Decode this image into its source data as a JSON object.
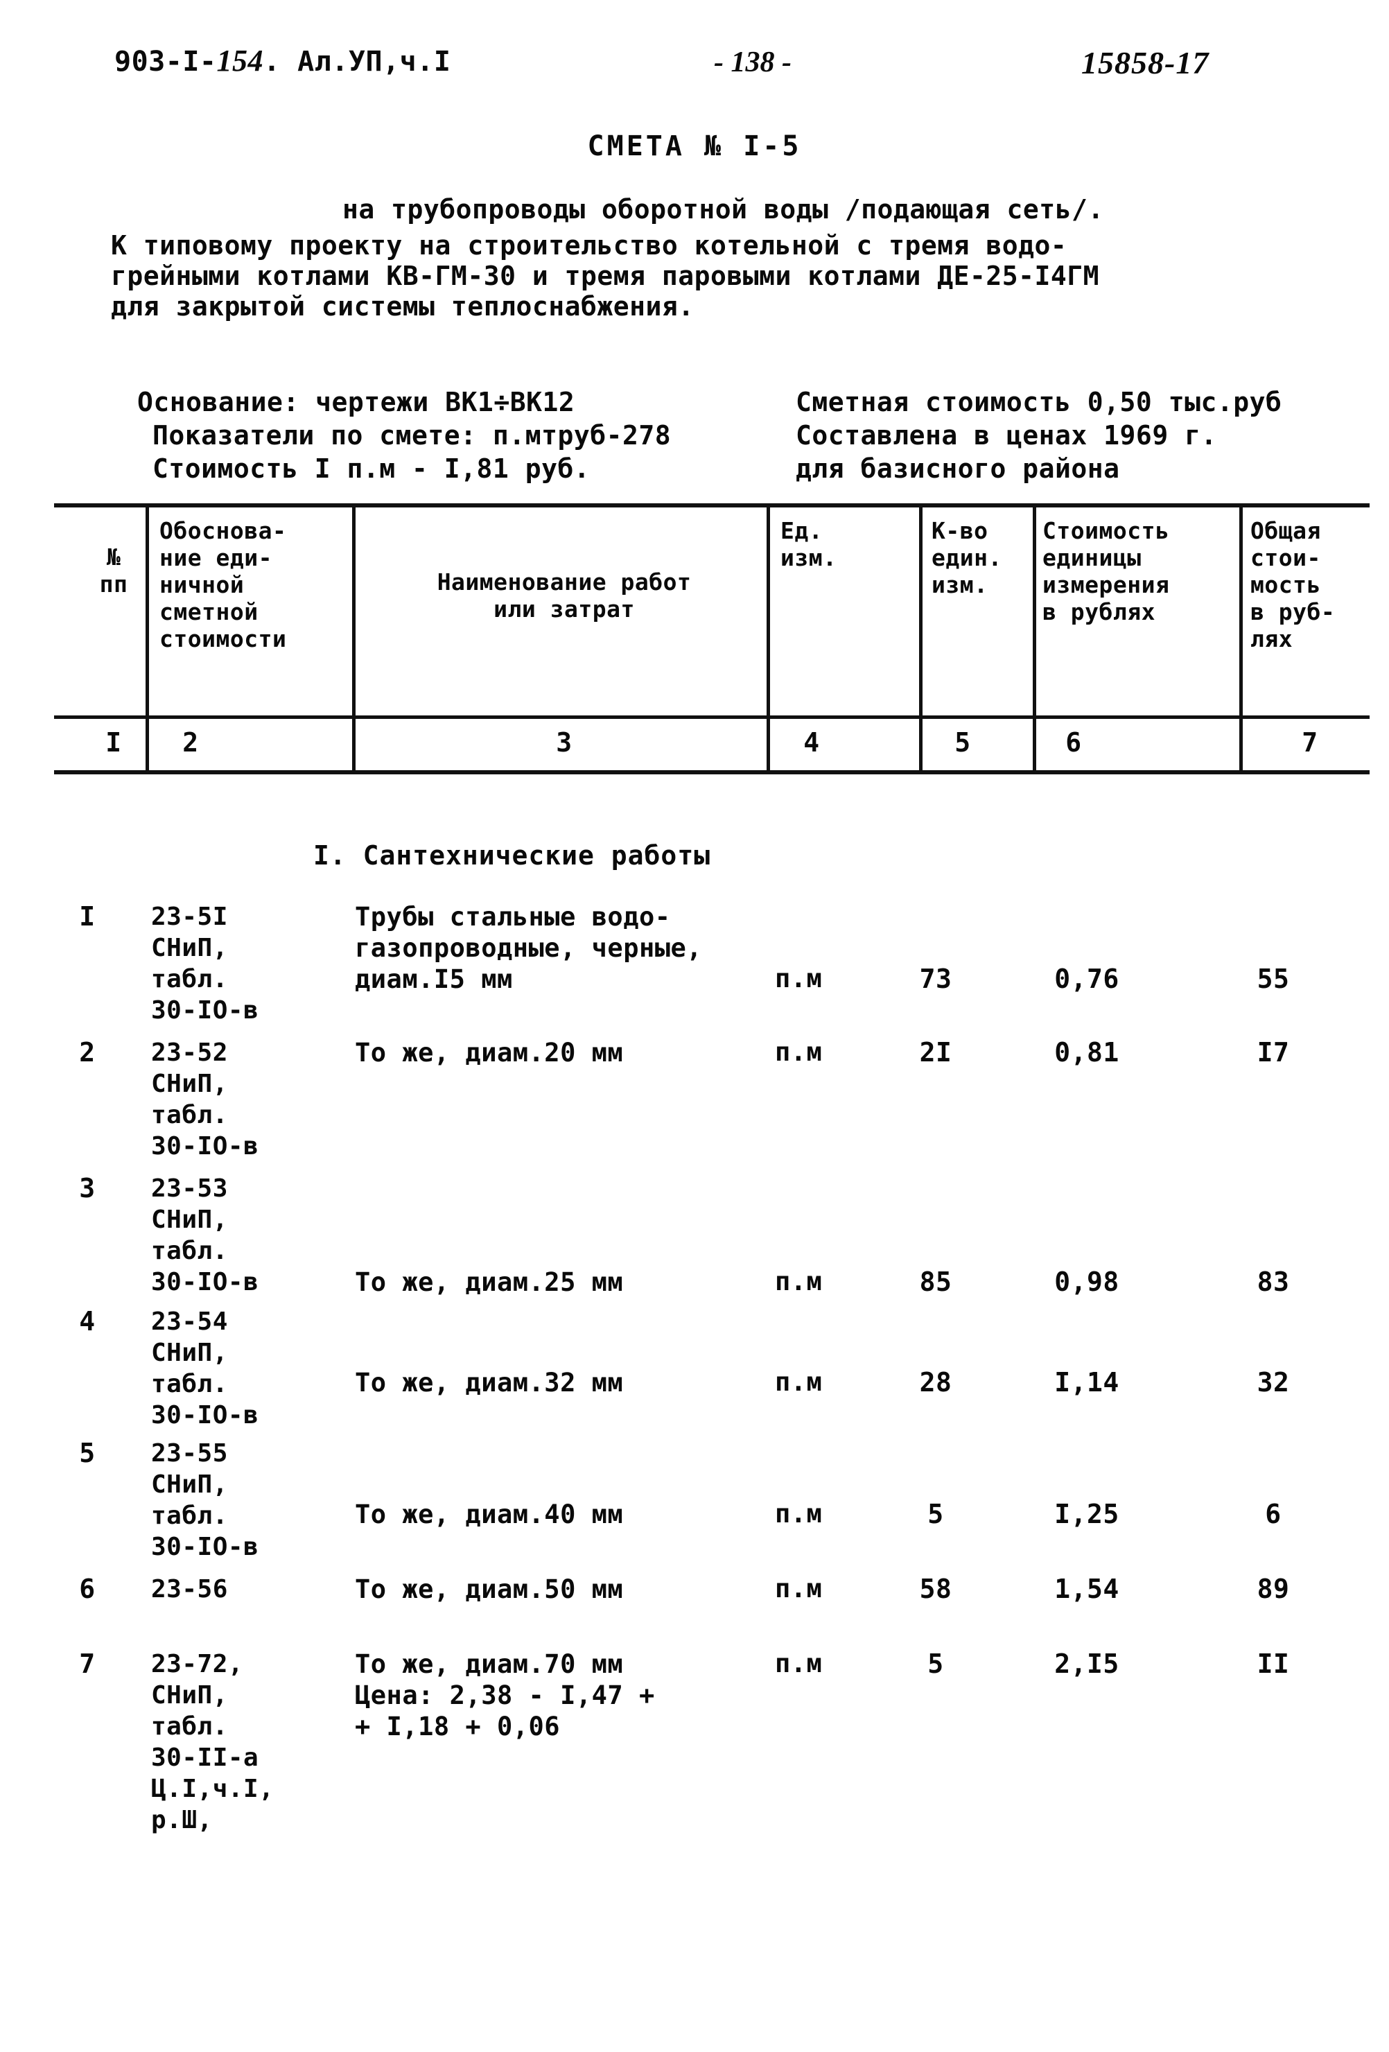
{
  "header": {
    "doc_code_prefix": "903-I-",
    "doc_code_hand": "154",
    "doc_code_suffix": ". Ал.УП,ч.I",
    "page_number": "- 138 -",
    "stamp_number": "15858-17"
  },
  "title": {
    "heading": "СМЕТА № I-5",
    "subtitle": "на трубопроводы оборотной воды /подающая сеть/.",
    "lead_lines": [
      "К типовому проекту на строительство котельной с тремя водо-",
      "грейными котлами КВ-ГМ-30 и тремя паровыми котлами ДЕ-25-I4ГМ",
      "для закрытой системы теплоснабжения."
    ]
  },
  "info": {
    "left": [
      "Основание: чертежи ВК1÷ВК12",
      "Показатели по смете: п.мтруб-278",
      "Стоимость I п.м - I,81 руб."
    ],
    "right": [
      "Сметная стоимость 0,50 тыс.руб",
      "Составлена в ценах 1969 г.",
      "для базисного района"
    ]
  },
  "table": {
    "headers": [
      "№\nпп",
      "Обоснова-\nние еди-\nничной\nсметной\nстоимости",
      "Наименование работ\nили затрат",
      "Ед.\nизм.",
      "К-во\nедин.\nизм.",
      "Стоимость\nединицы\nизмерения\nв рублях",
      "Общая\nстои-\nмость\nв руб-\nлях"
    ],
    "column_numbers": [
      "I",
      "2",
      "3",
      "4",
      "5",
      "6",
      "7"
    ],
    "section_heading": "I. Сантехнические работы",
    "rows": [
      {
        "num": "I",
        "basis": "23-5I\nСНиП,\nтабл.\n30-IO-в",
        "desc": "Трубы стальные водо-\nгазопроводные, черные,\nдиам.I5 мм",
        "unit": "п.м",
        "qty": "73",
        "price": "0,76",
        "total": "55"
      },
      {
        "num": "2",
        "basis": "23-52\nСНиП,\nтабл.\n30-IO-в",
        "desc": "То же, диам.20 мм",
        "unit": "п.м",
        "qty": "2I",
        "price": "0,81",
        "total": "I7"
      },
      {
        "num": "3",
        "basis": "23-53\nСНиП,\nтабл.\n30-IO-в",
        "desc": "То же, диам.25 мм",
        "unit": "п.м",
        "qty": "85",
        "price": "0,98",
        "total": "83"
      },
      {
        "num": "4",
        "basis": "23-54\nСНиП,\nтабл.\n30-IO-в",
        "desc": "То же, диам.32 мм",
        "unit": "п.м",
        "qty": "28",
        "price": "I,14",
        "total": "32"
      },
      {
        "num": "5",
        "basis": "23-55\nСНиП,\nтабл.\n30-IO-в",
        "desc": "То же, диам.40 мм",
        "unit": "п.м",
        "qty": "5",
        "price": "I,25",
        "total": "6"
      },
      {
        "num": "6",
        "basis": "23-56",
        "desc": "То же, диам.50 мм",
        "unit": "п.м",
        "qty": "58",
        "price": "1,54",
        "total": "89"
      },
      {
        "num": "7",
        "basis": "23-72,\nСНиП,\nтабл.\n30-II-а\nЦ.I,ч.I,\nр.Ш,",
        "desc": "То же, диам.70 мм\nЦена: 2,38 - I,47 +\n+ I,18 + 0,06",
        "unit": "п.м",
        "qty": "5",
        "price": "2,I5",
        "total": "II"
      }
    ]
  }
}
